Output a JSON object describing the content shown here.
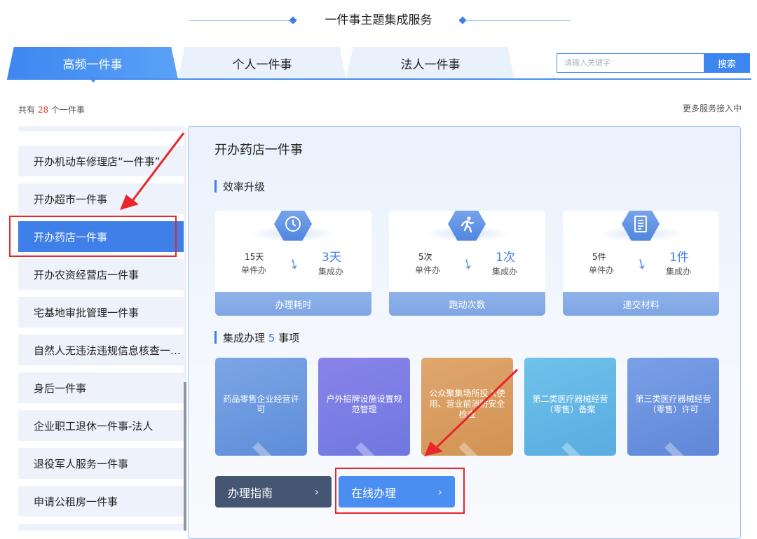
{
  "header": {
    "title": "一件事主题集成服务"
  },
  "tabs": [
    {
      "label": "高频一件事",
      "active": true
    },
    {
      "label": "个人一件事",
      "active": false
    },
    {
      "label": "法人一件事",
      "active": false
    }
  ],
  "search": {
    "placeholder": "请输入关键字",
    "button_label": "搜索"
  },
  "summary": {
    "prefix": "共有 ",
    "count": "28",
    "suffix": " 个一件事",
    "more_label": "更多服务接入中"
  },
  "sidebar": {
    "items": [
      {
        "label": "开办机动车修理店“一件事”"
      },
      {
        "label": "开办超市一件事"
      },
      {
        "label": "开办药店一件事",
        "active": true
      },
      {
        "label": "开办农资经营店一件事"
      },
      {
        "label": "宅基地审批管理一件事"
      },
      {
        "label": "自然人无违法违规信息核查一…"
      },
      {
        "label": "身后一件事"
      },
      {
        "label": "企业职工退休一件事-法人"
      },
      {
        "label": "退役军人服务一件事"
      },
      {
        "label": "申请公租房一件事"
      }
    ]
  },
  "panel": {
    "title": "开办药店一件事",
    "efficiency_title": "效率升级",
    "cards": [
      {
        "icon": "clock-icon",
        "before_value": "15天",
        "before_label": "单件办",
        "after_value": "3天",
        "after_label": "集成办",
        "footer": "办理耗时"
      },
      {
        "icon": "running-icon",
        "before_value": "5次",
        "before_label": "单件办",
        "after_value": "1次",
        "after_label": "集成办",
        "footer": "跑动次数"
      },
      {
        "icon": "document-icon",
        "before_value": "5件",
        "before_label": "单件办",
        "after_value": "1件",
        "after_label": "集成办",
        "footer": "递交材料"
      }
    ],
    "integrated": {
      "prefix": "集成办理 ",
      "count": "5",
      "suffix": " 事项"
    },
    "tiles": [
      {
        "label": "药品零售企业经营许可",
        "color": "#6a9ae0"
      },
      {
        "label": "户外招牌设施设置规范管理",
        "color": "#7f7ce6"
      },
      {
        "label": "公众聚集场所投入使用、营业前消防安全检查",
        "color": "#dba061"
      },
      {
        "label": "第二类医疗器械经营（零售）备案",
        "color": "#61b8e3"
      },
      {
        "label": "第三类医疗器械经营（零售）许可",
        "color": "#6d92e0"
      }
    ],
    "buttons": {
      "guide_label": "办理指南",
      "online_label": "在线办理"
    }
  },
  "colors": {
    "accent": "#3e7fe8",
    "highlight_red": "#e8262b",
    "count_red": "#e8453c"
  }
}
